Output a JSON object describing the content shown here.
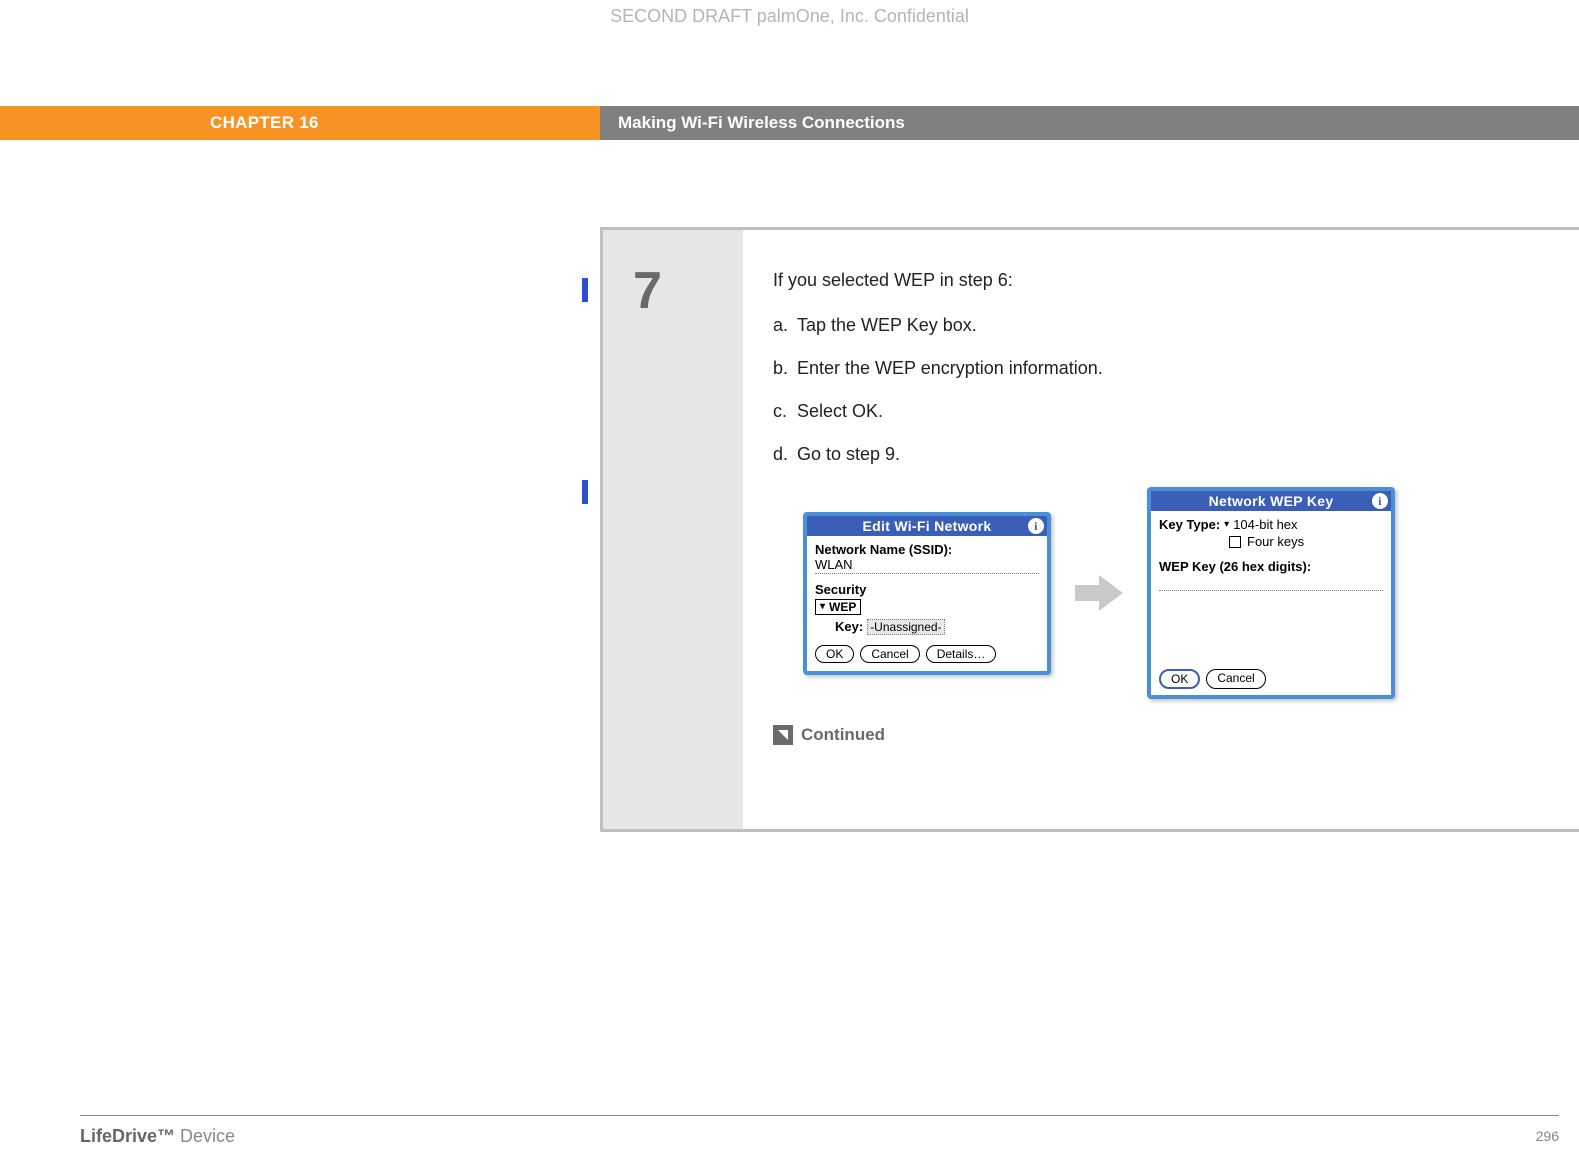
{
  "draft_header": "SECOND DRAFT palmOne, Inc.  Confidential",
  "header": {
    "chapter": "CHAPTER 16",
    "title": "Making Wi-Fi Wireless Connections"
  },
  "step": {
    "number": "7",
    "intro": "If you selected WEP in step 6:",
    "items": [
      {
        "letter": "a.",
        "text": "Tap the WEP Key box."
      },
      {
        "letter": "b.",
        "text": "Enter the WEP encryption information."
      },
      {
        "letter": "c.",
        "text": "Select OK."
      },
      {
        "letter": "d.",
        "text": "Go to step 9."
      }
    ],
    "continued": "Continued"
  },
  "screen1": {
    "title": "Edit Wi-Fi Network",
    "ssid_label": "Network Name (SSID):",
    "ssid_value": "WLAN",
    "security_heading": "Security",
    "security_value": "WEP",
    "key_label": "Key:",
    "key_value": "-Unassigned-",
    "ok": "OK",
    "cancel": "Cancel",
    "details": "Details…"
  },
  "screen2": {
    "title": "Network WEP Key",
    "key_type_label": "Key Type:",
    "key_type_value": "104-bit hex",
    "four_keys": "Four keys",
    "wep_key_label": "WEP Key (26 hex digits):",
    "ok": "OK",
    "cancel": "Cancel"
  },
  "footer": {
    "product_bold": "LifeDrive™",
    "product_rest": " Device",
    "page": "296"
  }
}
